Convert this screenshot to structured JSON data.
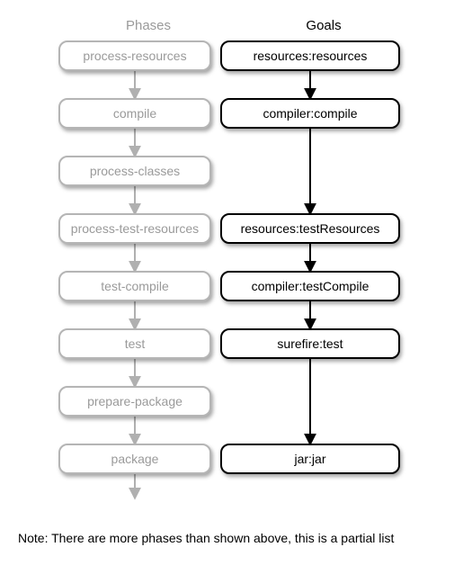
{
  "headers": {
    "phases": "Phases",
    "goals": "Goals"
  },
  "phases": [
    {
      "label": "process-resources"
    },
    {
      "label": "compile"
    },
    {
      "label": "process-classes"
    },
    {
      "label": "process-test-resources"
    },
    {
      "label": "test-compile"
    },
    {
      "label": "test"
    },
    {
      "label": "prepare-package"
    },
    {
      "label": "package"
    }
  ],
  "goals": [
    {
      "label": "resources:resources",
      "attachedToPhaseIndex": 0
    },
    {
      "label": "compiler:compile",
      "attachedToPhaseIndex": 1
    },
    {
      "label": "resources:testResources",
      "attachedToPhaseIndex": 3
    },
    {
      "label": "compiler:testCompile",
      "attachedToPhaseIndex": 4
    },
    {
      "label": "surefire:test",
      "attachedToPhaseIndex": 5
    },
    {
      "label": "jar:jar",
      "attachedToPhaseIndex": 7
    }
  ],
  "footnote": "Note: There are more phases than shown above, this is a partial list",
  "layout": {
    "phaseColumnX": 45,
    "goalColumnX": 225,
    "firstRowY": 25,
    "rowGap": 64,
    "nodeHeight": 34,
    "phaseWidth": 170,
    "goalWidth": 200,
    "phaseArrowX": 130,
    "goalArrowX": 325,
    "finalTailLength": 26
  }
}
